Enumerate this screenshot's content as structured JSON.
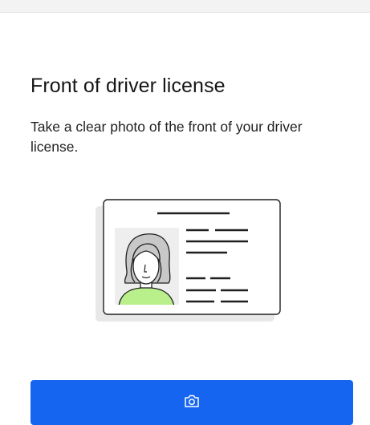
{
  "header": {
    "title": "Front of driver license",
    "description": "Take a clear photo of the front of your driver license."
  },
  "illustration": {
    "name": "driver-license-card",
    "icon": "id-card-illustration"
  },
  "actions": {
    "capture_icon": "camera-icon"
  },
  "colors": {
    "primary_button": "#1565f0",
    "title_text": "#161616",
    "avatar_shirt": "#b9f08c",
    "card_shadow": "#e9e9e9"
  }
}
